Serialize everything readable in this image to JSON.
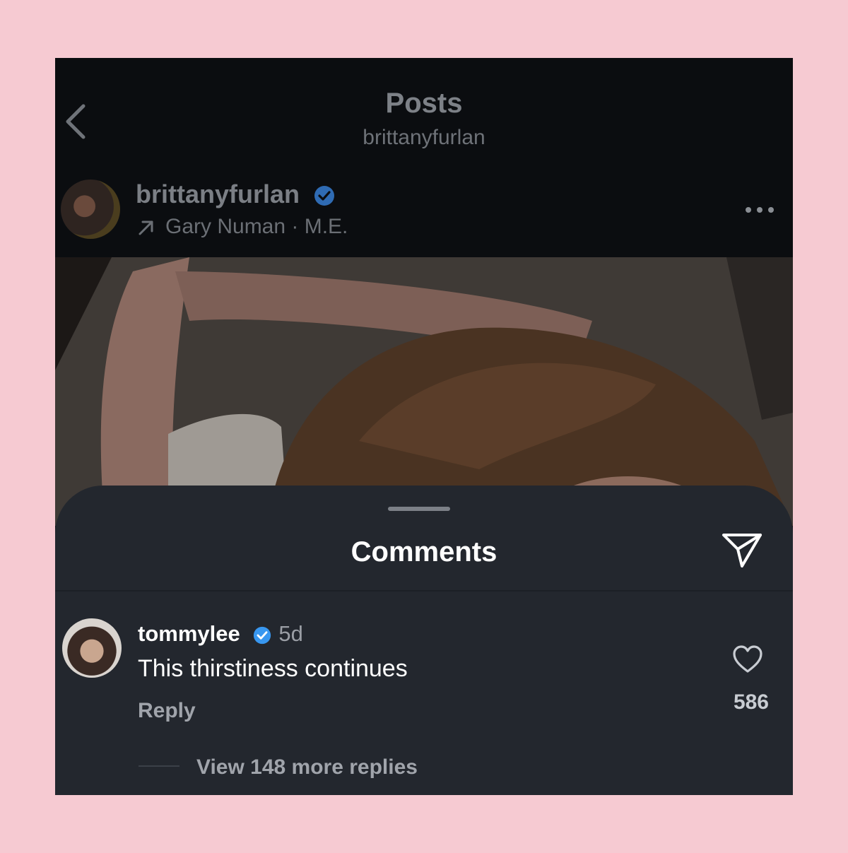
{
  "header": {
    "title": "Posts",
    "subtitle": "brittanyfurlan"
  },
  "post": {
    "username": "brittanyfurlan",
    "music": "Gary Numan · M.E."
  },
  "comments_sheet": {
    "title": "Comments",
    "comment": {
      "username": "tommylee",
      "time": "5d",
      "text": "This thirstiness continues",
      "reply_label": "Reply",
      "likes": "586"
    },
    "view_replies": "View 148 more replies"
  },
  "colors": {
    "background": "#f6cad2",
    "verified": "#3897f0",
    "sheet": "#23272e"
  },
  "icons": [
    "back-chevron-icon",
    "verified-badge-icon",
    "arrow-up-right-icon",
    "more-dots-icon",
    "share-send-icon",
    "heart-icon"
  ]
}
